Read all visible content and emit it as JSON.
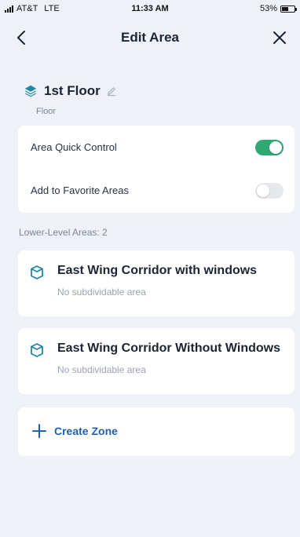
{
  "status_bar": {
    "carrier": "AT&T",
    "network": "LTE",
    "time": "11:33 AM",
    "battery": "53%",
    "battery_level": 0.53
  },
  "nav": {
    "title": "Edit Area",
    "back_icon": "chevron-left-icon",
    "close_icon": "close-icon"
  },
  "area": {
    "name": "1st Floor",
    "type": "Floor",
    "icon": "layers-icon",
    "edit_icon": "pencil-icon"
  },
  "settings": [
    {
      "label": "Area Quick Control",
      "enabled": true
    },
    {
      "label": "Add to Favorite Areas",
      "enabled": false
    }
  ],
  "lower_level": {
    "title": "Lower-Level Areas: 2",
    "items": [
      {
        "name": "East Wing Corridor with windows",
        "subtitle": "No subdividable area"
      },
      {
        "name": "East Wing Corridor Without Windows",
        "subtitle": "No subdividable area"
      }
    ]
  },
  "create_zone": {
    "label": "Create Zone",
    "icon": "plus-icon"
  },
  "colors": {
    "accent_blue": "#1f5fb4",
    "toggle_on": "#2fa871",
    "toggle_off": "#e6e8ec",
    "background": "#eef2f8",
    "area_icon": "#1f86a8"
  }
}
